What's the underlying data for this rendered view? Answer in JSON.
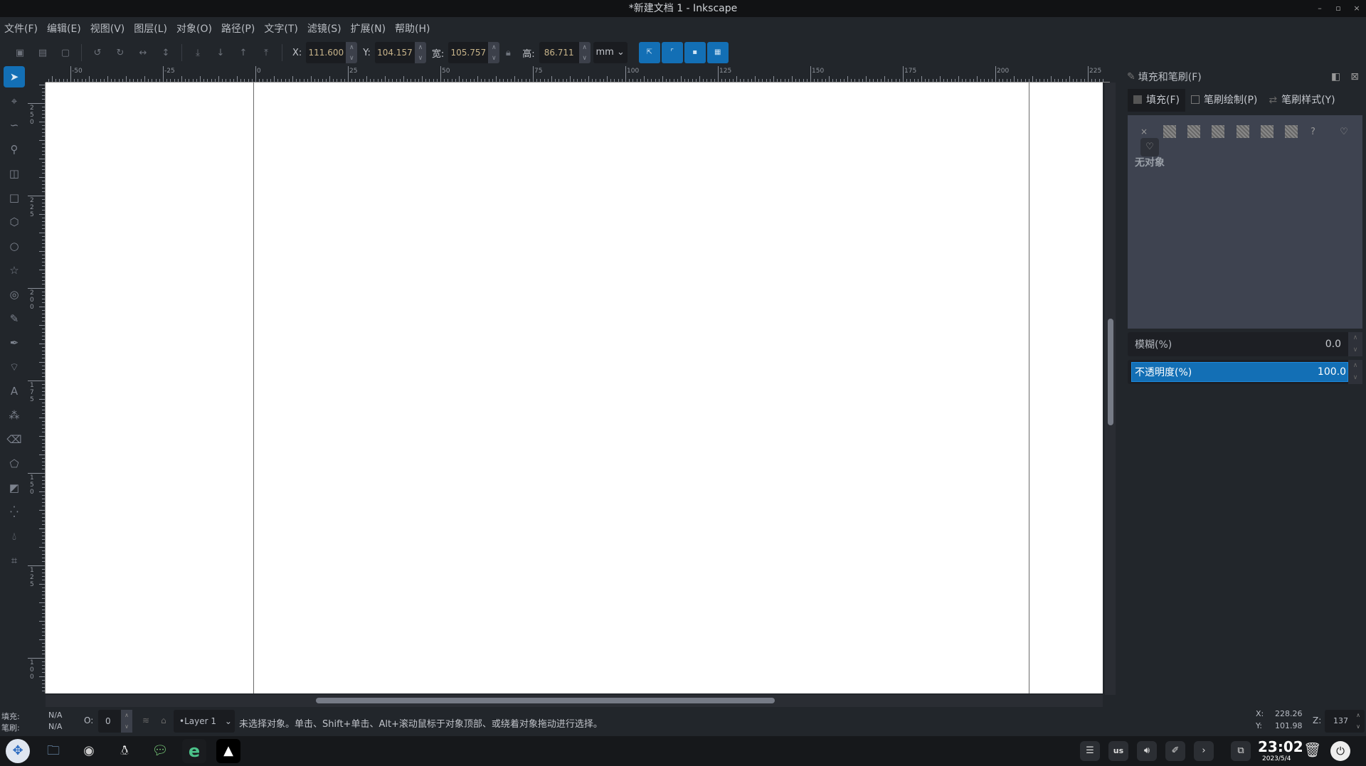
{
  "window": {
    "title": "*新建文档 1 - Inkscape",
    "controls": [
      "–",
      "▫",
      "×"
    ]
  },
  "menu": [
    "文件(F)",
    "编辑(E)",
    "视图(V)",
    "图层(L)",
    "对象(O)",
    "路径(P)",
    "文字(T)",
    "滤镜(S)",
    "扩展(N)",
    "帮助(H)"
  ],
  "toolbar": {
    "x_label": "X:",
    "x_value": "111.600",
    "y_label": "Y:",
    "y_value": "104.157",
    "w_label": "宽:",
    "w_value": "105.757",
    "h_label": "高:",
    "h_value": "86.711",
    "unit": "mm"
  },
  "tools": [
    "selector",
    "node",
    "tweak",
    "zoom",
    "measure",
    "rectangle",
    "3d-box",
    "ellipse",
    "star",
    "spiral",
    "pencil",
    "pen",
    "calligraphy",
    "text",
    "spray",
    "eraser",
    "paint-bucket",
    "gradient",
    "mesh",
    "dropper",
    "connector"
  ],
  "rulers": {
    "horizontal": [
      "-50",
      "-25",
      "0",
      "25",
      "50",
      "75",
      "100",
      "125",
      "150",
      "175",
      "200",
      "225"
    ],
    "vertical": [
      "250",
      "225",
      "200",
      "175",
      "150",
      "125",
      "100"
    ]
  },
  "panel": {
    "title": "填充和笔刷(F)",
    "tabs": [
      "填充(F)",
      "笔刷绘制(P)",
      "笔刷样式(Y)"
    ],
    "no_object": "无对象",
    "blur_label": "模糊(%)",
    "blur_value": "0.0",
    "opacity_label": "不透明度(%)",
    "opacity_value": "100.0"
  },
  "status": {
    "fill_label": "填充:",
    "fill_value": "N/A",
    "stroke_label": "笔刷:",
    "stroke_value": "N/A",
    "opacity_label": "O:",
    "opacity_value": "0",
    "layer": "•Layer 1",
    "message": "未选择对象。单击、Shift+单击、Alt+滚动鼠标于对象顶部、或绕着对象拖动进行选择。",
    "cursor_x_label": "X:",
    "cursor_x": "228.26",
    "cursor_y_label": "Y:",
    "cursor_y": "101.98",
    "zoom_label": "Z:",
    "zoom": "137"
  },
  "taskbar": {
    "keyboard": "us",
    "time": "23:02",
    "date": "2023/5/4"
  },
  "colors": {
    "accent": "#136fb5",
    "canvas": "#ffffff",
    "background": "#22262b"
  }
}
